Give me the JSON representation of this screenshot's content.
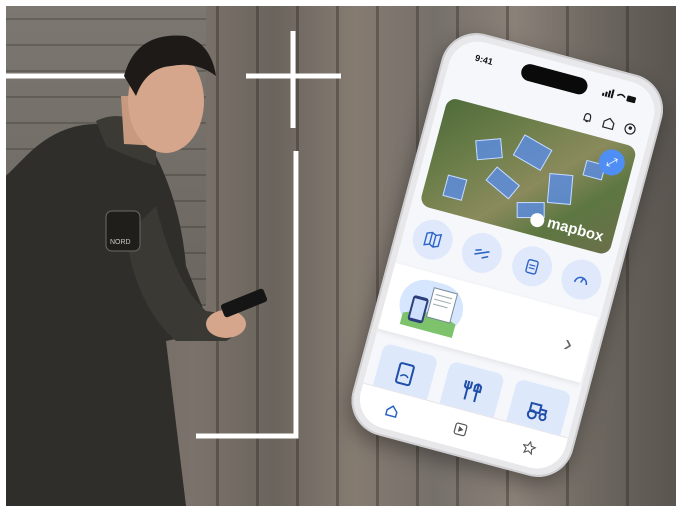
{
  "status_bar": {
    "time": "9:41"
  },
  "map": {
    "attribution": "mapbox"
  },
  "colors": {
    "accent": "#4f8ef5",
    "tile_bg": "#dde8fb",
    "quick_bg": "#dfe9fb"
  },
  "header_icons": [
    "bell-icon",
    "farm-user-icon",
    "profile-icon"
  ],
  "quick_actions": [
    "map-icon",
    "tractor-field-icon",
    "clipboard-icon",
    "gauge-icon"
  ],
  "feature_tiles": [
    "document-icon",
    "fork-shovel-icon",
    "tractor-icon"
  ],
  "tab_bar": [
    "home-icon",
    "play-icon",
    "star-icon"
  ],
  "person": {
    "badge_text": "NORD"
  }
}
